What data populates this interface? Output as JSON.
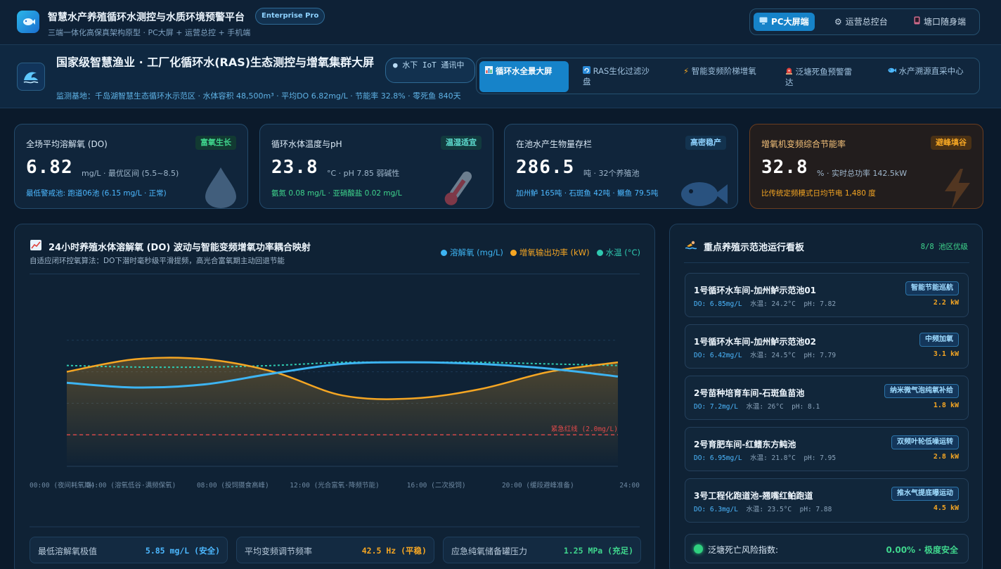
{
  "header": {
    "title": "智慧水产养殖循环水测控与水质环境预警平台",
    "edition": "Enterprise Pro",
    "subtitle": "三端一体化高保真架构原型 · PC大屏 + 运营总控 + 手机端",
    "views": [
      {
        "label": "PC大屏端",
        "icon": "monitor-icon",
        "active": true
      },
      {
        "label": "运营总控台",
        "icon": "gear-icon",
        "active": false
      },
      {
        "label": "塘口随身端",
        "icon": "phone-icon",
        "active": false
      }
    ]
  },
  "subheader": {
    "title": "国家级智慧渔业 · 工厂化循环水(RAS)生态测控与增氧集群大屏",
    "iot_badge": "● 水下 IoT 通讯中",
    "site_info": "监测基地：千岛湖智慧生态循环水示范区 · 水体容积 48,500m³ · 平均DO 6.82mg/L · 节能率 32.8% · 零死鱼 840天",
    "modules": [
      {
        "label": "循环水全景大屏",
        "icon": "bar-chart-icon",
        "active": true
      },
      {
        "label": "RAS生化过滤沙盘",
        "icon": "recycle-icon",
        "active": false
      },
      {
        "label": "智能变频阶梯增氧",
        "icon": "lightning-icon",
        "active": false
      },
      {
        "label": "泛塘死鱼预警雷达",
        "icon": "alarm-icon",
        "active": false
      },
      {
        "label": "水产溯源直采中心",
        "icon": "fish-icon",
        "active": false
      }
    ]
  },
  "kpis": [
    {
      "title": "全场平均溶解氧 (DO)",
      "badge": "富氧生长",
      "value": "6.82",
      "unit": "mg/L · 最优区间 (5.5~8.5)",
      "foot": "最低警戒池: 跑道06池 (6.15 mg/L · 正常)",
      "deco": "droplet-icon"
    },
    {
      "title": "循环水体温度与pH",
      "badge": "温湿适宜",
      "value": "23.8",
      "unit": "°C · pH 7.85 弱碱性",
      "foot": "氨氮 0.08 mg/L · 亚硝酸盐 0.02 mg/L",
      "deco": "thermometer-icon"
    },
    {
      "title": "在池水产生物量存栏",
      "badge": "高密稳产",
      "value": "286.5",
      "unit": "吨 · 32个养殖池",
      "foot": "加州鲈 165吨 · 石斑鱼 42吨 · 鳜鱼 79.5吨",
      "deco": "fish-icon"
    },
    {
      "title": "增氧机变频综合节能率",
      "badge": "避峰填谷",
      "value": "32.8",
      "unit": "% · 实时总功率 142.5kW",
      "foot": "比传统定频模式日均节电 1,480 度",
      "deco": "lightning-icon"
    }
  ],
  "chart_panel": {
    "title": "24小时养殖水体溶解氧 (DO) 波动与智能变频增氧功率耦合映射",
    "subtitle": "自适应闭环控氧算法：DO下潜时毫秒级平滑提频，高光合富氧期主动回退节能",
    "title_icon": "trend-chart-icon",
    "stats": [
      {
        "label": "最低溶解氧极值",
        "value": "5.85 mg/L (安全)",
        "color": "#4cb8ff"
      },
      {
        "label": "平均变频调节频率",
        "value": "42.5 Hz (平稳)",
        "color": "#f5a623"
      },
      {
        "label": "应急纯氧储备罐压力",
        "value": "1.25 MPa (充足)",
        "color": "#3fd68d"
      }
    ]
  },
  "chart_data": {
    "type": "line",
    "x": [
      "00:00",
      "04:00",
      "08:00",
      "12:00",
      "16:00",
      "20:00",
      "24:00"
    ],
    "x_tick_labels": [
      "00:00 (夜间耗氧期)",
      "04:00 (溶氧低谷·满频保氧)",
      "08:00 (投饲摄食高峰)",
      "12:00 (光合富氧·降频节能)",
      "16:00 (二次投饲)",
      "20:00 (缓段避峰准备)",
      "24:00"
    ],
    "series": [
      {
        "name": "溶解氧 (mg/L)",
        "color": "#3db4f2",
        "values": [
          5.3,
          5.0,
          5.2,
          5.9,
          6.5,
          6.6,
          6.5,
          6.2,
          5.7
        ]
      },
      {
        "name": "增氧输出功率 (kW)",
        "color": "#f5a623",
        "values": [
          6.0,
          6.8,
          6.8,
          6.0,
          4.5,
          4.3,
          4.9,
          6.0,
          6.6
        ]
      },
      {
        "name": "水温 (°C)",
        "color": "#2fc9b0",
        "values": [
          6.4,
          6.3,
          6.3,
          6.4,
          6.6,
          6.6,
          6.6,
          6.5,
          6.4
        ]
      }
    ],
    "threshold": {
      "label": "紧急红线 (2.0mg/L)",
      "value": 2.0,
      "color": "#e24a4a"
    },
    "ylim": [
      0,
      10
    ],
    "grid": true,
    "legend": "top-right"
  },
  "board": {
    "title": "重点养殖示范池运行看板",
    "title_icon": "swimmer-icon",
    "count": "8/8 池区优级",
    "ponds": [
      {
        "name": "1号循环水车间-加州鲈示范池01",
        "tag": "智能节能巡航",
        "do": "DO: 6.85mg/L",
        "temp": "水温: 24.2°C",
        "ph": "pH: 7.82",
        "power": "2.2 kW"
      },
      {
        "name": "1号循环水车间-加州鲈示范池02",
        "tag": "中频加氧",
        "do": "DO: 6.42mg/L",
        "temp": "水温: 24.5°C",
        "ph": "pH: 7.79",
        "power": "3.1 kW"
      },
      {
        "name": "2号苗种培育车间-石斑鱼苗池",
        "tag": "纳米微气泡纯氧补给",
        "do": "DO: 7.2mg/L",
        "temp": "水温: 26°C",
        "ph": "pH: 8.1",
        "power": "1.8 kW"
      },
      {
        "name": "2号育肥车间-红鳍东方鲀池",
        "tag": "双频叶轮低噪运转",
        "do": "DO: 6.95mg/L",
        "temp": "水温: 21.8°C",
        "ph": "pH: 7.95",
        "power": "2.8 kW"
      },
      {
        "name": "3号工程化跑道池-翘嘴红鲌跑道",
        "tag": "推水气提底曝运动",
        "do": "DO: 6.3mg/L",
        "temp": "水温: 23.5°C",
        "ph": "pH: 7.88",
        "power": "4.5 kW"
      }
    ],
    "risk_label": "泛塘死亡风险指数:",
    "risk_value": "0.00% · 极度安全"
  },
  "colors": {
    "accent": "#1683c9",
    "good": "#3fd68d",
    "warn": "#f5a623",
    "danger": "#e24a4a",
    "do": "#4cb8ff"
  }
}
